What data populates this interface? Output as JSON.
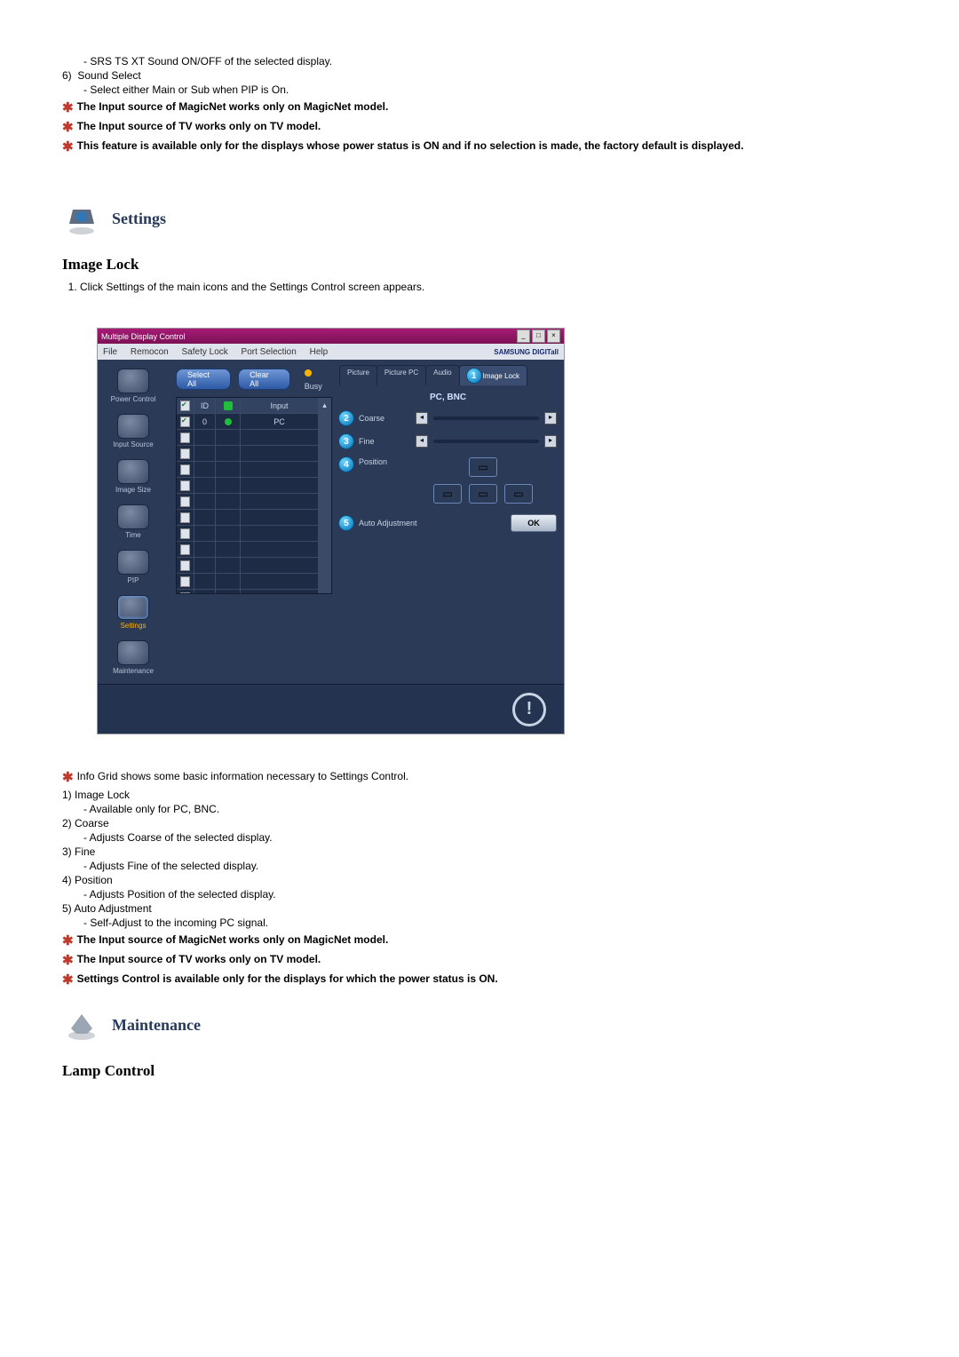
{
  "upper_block": {
    "line_sub": "- SRS TS XT Sound ON/OFF of the selected display.",
    "item6_num": "6)",
    "item6_label": "Sound Select",
    "item6_sub": "- Select either Main or Sub when PIP is On.",
    "star1": "The Input source of MagicNet works only on MagicNet model.",
    "star2": "The Input source of TV works only on TV model.",
    "star3": "This feature is available only for the displays whose power status is ON and if no selection is made, the factory default is displayed."
  },
  "settings_section": {
    "title": "Settings",
    "head2": "Image Lock",
    "step1": "Click Settings of the main icons and the Settings Control screen appears."
  },
  "screenshot": {
    "title": "Multiple Display Control",
    "menus": [
      "File",
      "Remocon",
      "Safety Lock",
      "Port Selection",
      "Help"
    ],
    "brand": "SAMSUNG DIGITall",
    "sidebar": [
      {
        "label": "Power Control",
        "active": false
      },
      {
        "label": "Input Source",
        "active": false
      },
      {
        "label": "Image Size",
        "active": false
      },
      {
        "label": "Time",
        "active": false
      },
      {
        "label": "PIP",
        "active": false
      },
      {
        "label": "Settings",
        "active": true
      },
      {
        "label": "Maintenance",
        "active": false
      }
    ],
    "toolbar": {
      "select_all": "Select All",
      "clear_all": "Clear All",
      "busy": "Busy"
    },
    "grid": {
      "headers": {
        "id": "ID",
        "input": "Input"
      },
      "rows": [
        {
          "checked": true,
          "id": "0",
          "status": "green",
          "input": "PC"
        }
      ],
      "blank_rows": 11
    },
    "tabs": [
      {
        "label": "Picture",
        "active": false
      },
      {
        "label": "Picture PC",
        "active": false
      },
      {
        "label": "Audio",
        "active": false
      },
      {
        "label": "Image Lock",
        "active": true,
        "badge": "1"
      }
    ],
    "panel_title": "PC, BNC",
    "controls": {
      "coarse": {
        "num": "2",
        "label": "Coarse"
      },
      "fine": {
        "num": "3",
        "label": "Fine"
      },
      "position": {
        "num": "4",
        "label": "Position"
      },
      "auto": {
        "num": "5",
        "label": "Auto Adjustment",
        "ok": "OK"
      }
    }
  },
  "lower_block": {
    "star_info": "Info Grid shows some basic information necessary to Settings Control.",
    "items": [
      {
        "num": "1)",
        "label": "Image Lock",
        "sub": "- Available only for PC, BNC."
      },
      {
        "num": "2)",
        "label": "Coarse",
        "sub": "- Adjusts Coarse of the selected display."
      },
      {
        "num": "3)",
        "label": "Fine",
        "sub": "- Adjusts Fine of the selected display."
      },
      {
        "num": "4)",
        "label": "Position",
        "sub": "- Adjusts Position of the selected display."
      },
      {
        "num": "5)",
        "label": "Auto Adjustment",
        "sub": "- Self-Adjust to the incoming PC signal."
      }
    ],
    "star1": "The Input source of MagicNet works only on MagicNet model.",
    "star2": "The Input source of TV works only on TV model.",
    "star3": "Settings Control is available only for the displays for which the power status is ON."
  },
  "maintenance_section": {
    "title": "Maintenance",
    "head2": "Lamp Control"
  }
}
